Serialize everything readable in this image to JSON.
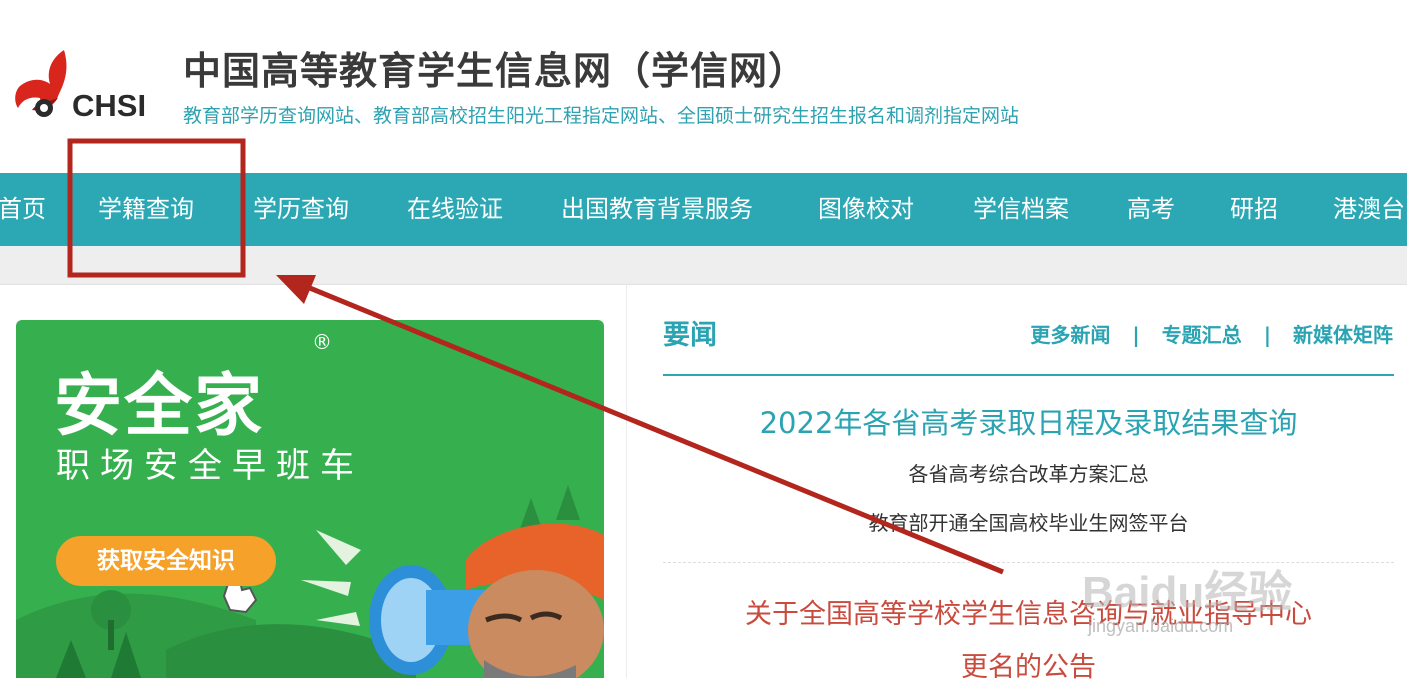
{
  "header": {
    "logo_text": "CHSI",
    "title": "中国高等教育学生信息网（学信网）",
    "subtitle": "教育部学历查询网站、教育部高校招生阳光工程指定网站、全国硕士研究生招生报名和调剂指定网站"
  },
  "nav": {
    "items": [
      {
        "label": "首页"
      },
      {
        "label": "学籍查询"
      },
      {
        "label": "学历查询"
      },
      {
        "label": "在线验证"
      },
      {
        "label": "出国教育背景服务"
      },
      {
        "label": "图像校对"
      },
      {
        "label": "学信档案"
      },
      {
        "label": "高考"
      },
      {
        "label": "研招"
      },
      {
        "label": "港澳台"
      }
    ]
  },
  "banner": {
    "brand": "安全家",
    "registered": "®",
    "tagline": "职场安全早班车",
    "cta": "获取安全知识"
  },
  "news": {
    "title": "要闻",
    "links": [
      "更多新闻",
      "专题汇总",
      "新媒体矩阵"
    ],
    "separator": "|",
    "headline": "2022年各省高考录取日程及录取结果查询",
    "items": [
      "各省高考综合改革方案汇总",
      "教育部开通全国高校毕业生网签平台"
    ],
    "notice_line1": "关于全国高等学校学生信息咨询与就业指导中心",
    "notice_line2": "更名的公告"
  },
  "watermark": {
    "brand": "Baidu经验",
    "url": "jingyan.baidu.com"
  },
  "colors": {
    "nav_bg": "#2ba8b4",
    "accent_teal": "#2aa3b2",
    "notice_red": "#c94b3e",
    "annotation_red": "#b3261e",
    "banner_green": "#36b04f",
    "cta_orange": "#f5a12a"
  }
}
